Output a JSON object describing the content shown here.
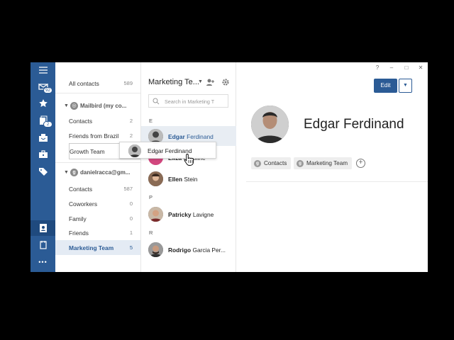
{
  "window": {
    "controls": {
      "help": "?",
      "minimize": "–",
      "maximize": "□",
      "close": "✕"
    }
  },
  "rail": {
    "inbox_badge": "92",
    "folders_badge": "2",
    "more": "•••"
  },
  "groups": {
    "all_contacts": {
      "label": "All contacts",
      "count": "589"
    },
    "account1": {
      "label": "Mailbird (my co..."
    },
    "account1_items": [
      {
        "label": "Contacts",
        "count": "2"
      },
      {
        "label": "Friends from Brazil",
        "count": "2"
      },
      {
        "label": "Growth Team",
        "count": ""
      }
    ],
    "account2": {
      "label": "danielracca@gm..."
    },
    "account2_items": [
      {
        "label": "Contacts",
        "count": "587"
      },
      {
        "label": "Coworkers",
        "count": "0"
      },
      {
        "label": "Family",
        "count": "0"
      },
      {
        "label": "Friends",
        "count": "1"
      },
      {
        "label": "Marketing Team",
        "count": "5"
      }
    ]
  },
  "contacts": {
    "title": "Marketing Te...",
    "search_placeholder": "Search in Marketing T",
    "letters": {
      "e": "E",
      "p": "P",
      "r": "R"
    },
    "rows": [
      {
        "first": "Edgar",
        "last": "Ferdinand"
      },
      {
        "first": "Eliza",
        "last": "Caroline"
      },
      {
        "first": "Ellen",
        "last": "Stein"
      },
      {
        "first": "Patricky",
        "last": "Lavigne"
      },
      {
        "first": "Rodrigo",
        "last": "Garcia Per..."
      }
    ],
    "drag_ghost": "Edgar Ferdinand"
  },
  "detail": {
    "edit_label": "Edit",
    "name": "Edgar Ferdinand",
    "tags": [
      "Contacts",
      "Marketing Team"
    ],
    "add_tag": "+"
  },
  "colors": {
    "accent": "#2b5b95",
    "selected_bg": "#e4ebf4"
  }
}
